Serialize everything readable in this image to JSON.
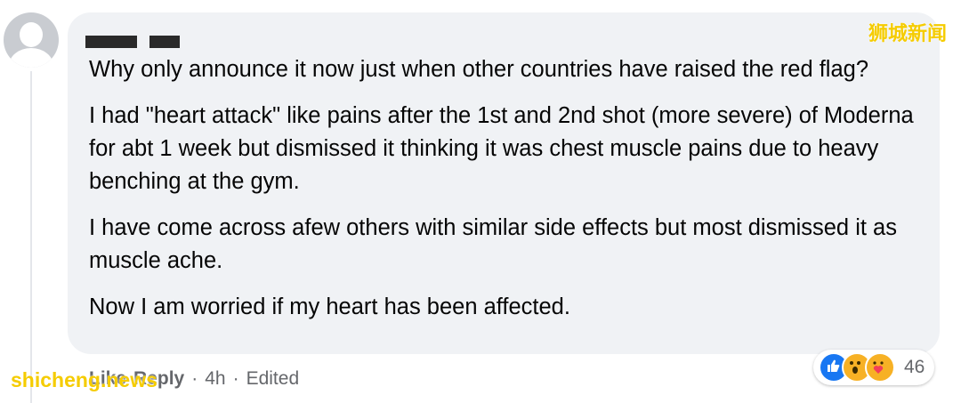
{
  "comment": {
    "paragraphs": [
      "Why only announce it now just when other countries have raised the red flag?",
      "I had \"heart attack\" like pains after the 1st and 2nd shot (more severe) of Moderna for abt 1 week but dismissed it thinking it was chest muscle pains due to heavy benching at the gym.",
      "I have come across afew others with similar side effects but most dismissed it as muscle ache.",
      "Now I am worried if my heart has been affected."
    ]
  },
  "actions": {
    "like_label": "Like",
    "reply_label": "Reply",
    "separator": "·",
    "time": "4h",
    "edited": "Edited"
  },
  "reactions": {
    "count": "46",
    "types": [
      "like-icon",
      "wow-icon",
      "care-icon"
    ],
    "colors": {
      "like": "#1877f2",
      "wow": "#f7b125",
      "care": "#f7b125"
    }
  },
  "watermarks": {
    "top": "狮城新闻",
    "bottom": "shicheng.news"
  }
}
